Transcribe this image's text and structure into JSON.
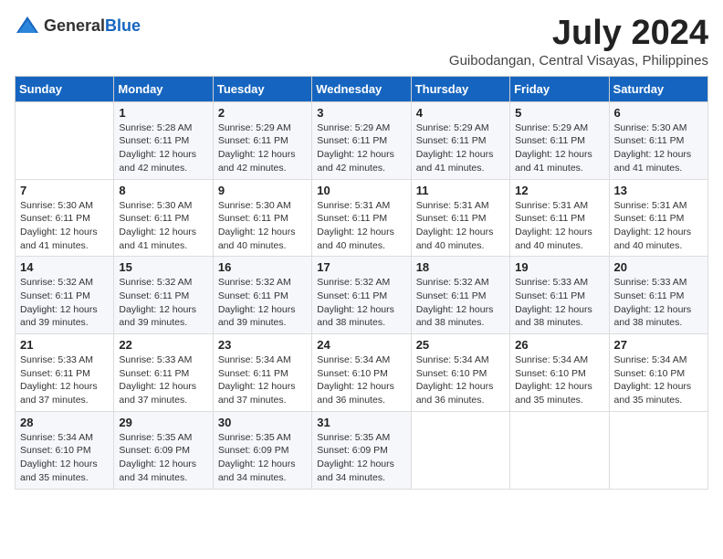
{
  "header": {
    "logo_general": "General",
    "logo_blue": "Blue",
    "month_title": "July 2024",
    "location": "Guibodangan, Central Visayas, Philippines"
  },
  "days_of_week": [
    "Sunday",
    "Monday",
    "Tuesday",
    "Wednesday",
    "Thursday",
    "Friday",
    "Saturday"
  ],
  "weeks": [
    [
      {
        "day": "",
        "sunrise": "",
        "sunset": "",
        "daylight": ""
      },
      {
        "day": "1",
        "sunrise": "Sunrise: 5:28 AM",
        "sunset": "Sunset: 6:11 PM",
        "daylight": "Daylight: 12 hours and 42 minutes."
      },
      {
        "day": "2",
        "sunrise": "Sunrise: 5:29 AM",
        "sunset": "Sunset: 6:11 PM",
        "daylight": "Daylight: 12 hours and 42 minutes."
      },
      {
        "day": "3",
        "sunrise": "Sunrise: 5:29 AM",
        "sunset": "Sunset: 6:11 PM",
        "daylight": "Daylight: 12 hours and 42 minutes."
      },
      {
        "day": "4",
        "sunrise": "Sunrise: 5:29 AM",
        "sunset": "Sunset: 6:11 PM",
        "daylight": "Daylight: 12 hours and 41 minutes."
      },
      {
        "day": "5",
        "sunrise": "Sunrise: 5:29 AM",
        "sunset": "Sunset: 6:11 PM",
        "daylight": "Daylight: 12 hours and 41 minutes."
      },
      {
        "day": "6",
        "sunrise": "Sunrise: 5:30 AM",
        "sunset": "Sunset: 6:11 PM",
        "daylight": "Daylight: 12 hours and 41 minutes."
      }
    ],
    [
      {
        "day": "7",
        "sunrise": "Sunrise: 5:30 AM",
        "sunset": "Sunset: 6:11 PM",
        "daylight": "Daylight: 12 hours and 41 minutes."
      },
      {
        "day": "8",
        "sunrise": "Sunrise: 5:30 AM",
        "sunset": "Sunset: 6:11 PM",
        "daylight": "Daylight: 12 hours and 41 minutes."
      },
      {
        "day": "9",
        "sunrise": "Sunrise: 5:30 AM",
        "sunset": "Sunset: 6:11 PM",
        "daylight": "Daylight: 12 hours and 40 minutes."
      },
      {
        "day": "10",
        "sunrise": "Sunrise: 5:31 AM",
        "sunset": "Sunset: 6:11 PM",
        "daylight": "Daylight: 12 hours and 40 minutes."
      },
      {
        "day": "11",
        "sunrise": "Sunrise: 5:31 AM",
        "sunset": "Sunset: 6:11 PM",
        "daylight": "Daylight: 12 hours and 40 minutes."
      },
      {
        "day": "12",
        "sunrise": "Sunrise: 5:31 AM",
        "sunset": "Sunset: 6:11 PM",
        "daylight": "Daylight: 12 hours and 40 minutes."
      },
      {
        "day": "13",
        "sunrise": "Sunrise: 5:31 AM",
        "sunset": "Sunset: 6:11 PM",
        "daylight": "Daylight: 12 hours and 40 minutes."
      }
    ],
    [
      {
        "day": "14",
        "sunrise": "Sunrise: 5:32 AM",
        "sunset": "Sunset: 6:11 PM",
        "daylight": "Daylight: 12 hours and 39 minutes."
      },
      {
        "day": "15",
        "sunrise": "Sunrise: 5:32 AM",
        "sunset": "Sunset: 6:11 PM",
        "daylight": "Daylight: 12 hours and 39 minutes."
      },
      {
        "day": "16",
        "sunrise": "Sunrise: 5:32 AM",
        "sunset": "Sunset: 6:11 PM",
        "daylight": "Daylight: 12 hours and 39 minutes."
      },
      {
        "day": "17",
        "sunrise": "Sunrise: 5:32 AM",
        "sunset": "Sunset: 6:11 PM",
        "daylight": "Daylight: 12 hours and 38 minutes."
      },
      {
        "day": "18",
        "sunrise": "Sunrise: 5:32 AM",
        "sunset": "Sunset: 6:11 PM",
        "daylight": "Daylight: 12 hours and 38 minutes."
      },
      {
        "day": "19",
        "sunrise": "Sunrise: 5:33 AM",
        "sunset": "Sunset: 6:11 PM",
        "daylight": "Daylight: 12 hours and 38 minutes."
      },
      {
        "day": "20",
        "sunrise": "Sunrise: 5:33 AM",
        "sunset": "Sunset: 6:11 PM",
        "daylight": "Daylight: 12 hours and 38 minutes."
      }
    ],
    [
      {
        "day": "21",
        "sunrise": "Sunrise: 5:33 AM",
        "sunset": "Sunset: 6:11 PM",
        "daylight": "Daylight: 12 hours and 37 minutes."
      },
      {
        "day": "22",
        "sunrise": "Sunrise: 5:33 AM",
        "sunset": "Sunset: 6:11 PM",
        "daylight": "Daylight: 12 hours and 37 minutes."
      },
      {
        "day": "23",
        "sunrise": "Sunrise: 5:34 AM",
        "sunset": "Sunset: 6:11 PM",
        "daylight": "Daylight: 12 hours and 37 minutes."
      },
      {
        "day": "24",
        "sunrise": "Sunrise: 5:34 AM",
        "sunset": "Sunset: 6:10 PM",
        "daylight": "Daylight: 12 hours and 36 minutes."
      },
      {
        "day": "25",
        "sunrise": "Sunrise: 5:34 AM",
        "sunset": "Sunset: 6:10 PM",
        "daylight": "Daylight: 12 hours and 36 minutes."
      },
      {
        "day": "26",
        "sunrise": "Sunrise: 5:34 AM",
        "sunset": "Sunset: 6:10 PM",
        "daylight": "Daylight: 12 hours and 35 minutes."
      },
      {
        "day": "27",
        "sunrise": "Sunrise: 5:34 AM",
        "sunset": "Sunset: 6:10 PM",
        "daylight": "Daylight: 12 hours and 35 minutes."
      }
    ],
    [
      {
        "day": "28",
        "sunrise": "Sunrise: 5:34 AM",
        "sunset": "Sunset: 6:10 PM",
        "daylight": "Daylight: 12 hours and 35 minutes."
      },
      {
        "day": "29",
        "sunrise": "Sunrise: 5:35 AM",
        "sunset": "Sunset: 6:09 PM",
        "daylight": "Daylight: 12 hours and 34 minutes."
      },
      {
        "day": "30",
        "sunrise": "Sunrise: 5:35 AM",
        "sunset": "Sunset: 6:09 PM",
        "daylight": "Daylight: 12 hours and 34 minutes."
      },
      {
        "day": "31",
        "sunrise": "Sunrise: 5:35 AM",
        "sunset": "Sunset: 6:09 PM",
        "daylight": "Daylight: 12 hours and 34 minutes."
      },
      {
        "day": "",
        "sunrise": "",
        "sunset": "",
        "daylight": ""
      },
      {
        "day": "",
        "sunrise": "",
        "sunset": "",
        "daylight": ""
      },
      {
        "day": "",
        "sunrise": "",
        "sunset": "",
        "daylight": ""
      }
    ]
  ]
}
